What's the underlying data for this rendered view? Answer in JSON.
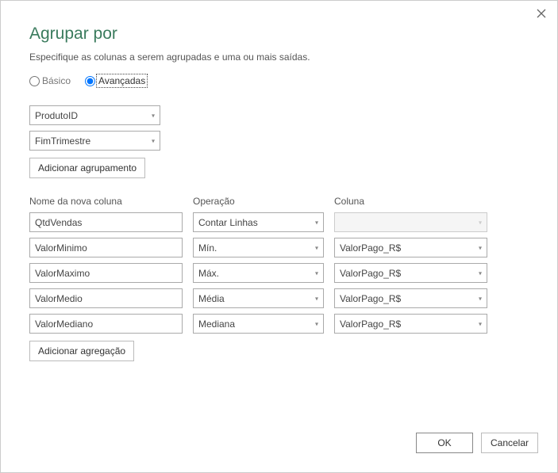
{
  "dialog": {
    "title": "Agrupar por",
    "subtitle": "Especifique as colunas a serem agrupadas e uma ou mais saídas."
  },
  "mode": {
    "basic": "Básico",
    "advanced": "Avançadas"
  },
  "groupings": {
    "0": "ProdutoID",
    "1": "FimTrimestre",
    "addLabel": "Adicionar agrupamento"
  },
  "headers": {
    "newCol": "Nome da nova coluna",
    "operation": "Operação",
    "column": "Coluna"
  },
  "rows": {
    "0": {
      "name": "QtdVendas",
      "op": "Contar Linhas",
      "col": ""
    },
    "1": {
      "name": "ValorMinimo",
      "op": "Mín.",
      "col": "ValorPago_R$"
    },
    "2": {
      "name": "ValorMaximo",
      "op": "Máx.",
      "col": "ValorPago_R$"
    },
    "3": {
      "name": "ValorMedio",
      "op": "Média",
      "col": "ValorPago_R$"
    },
    "4": {
      "name": "ValorMediano",
      "op": "Mediana",
      "col": "ValorPago_R$"
    }
  },
  "addAggLabel": "Adicionar agregação",
  "footer": {
    "ok": "OK",
    "cancel": "Cancelar"
  }
}
